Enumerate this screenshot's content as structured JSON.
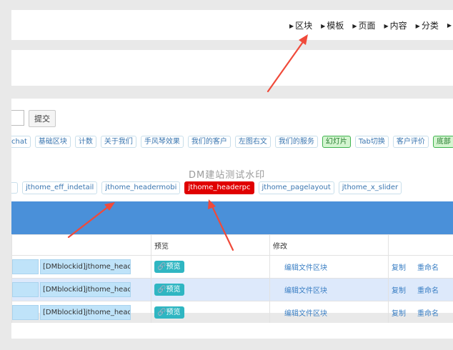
{
  "topnav": {
    "items": [
      "区块",
      "模板",
      "页面",
      "内容",
      "分类"
    ]
  },
  "toolbar": {
    "submit_label": "提交"
  },
  "tags": [
    {
      "label": "chat"
    },
    {
      "label": "基础区块"
    },
    {
      "label": "计数"
    },
    {
      "label": "关于我们"
    },
    {
      "label": "手风琴效果"
    },
    {
      "label": "我们的客户"
    },
    {
      "label": "左图右文"
    },
    {
      "label": "我们的服务"
    },
    {
      "label": "幻灯片",
      "highlight": true
    },
    {
      "label": "Tab切换"
    },
    {
      "label": "客户评价"
    },
    {
      "label": "底部",
      "highlight": true
    }
  ],
  "watermark": "DM建站测试水印",
  "templates": [
    "jthome_eff_indetail",
    "jthome_headermobi",
    "jthome_headerpc",
    "jthome_pagelayout",
    "jthome_x_slider"
  ],
  "active_template": "jthome_headerpc",
  "table": {
    "headers": [
      "",
      "预览",
      "修改",
      ""
    ],
    "rows": [
      {
        "id_value": "[DMblockid]jthome_header|",
        "preview_label": "预览",
        "edit_label": "编辑文件区块",
        "copy_label": "复制",
        "rename_label": "重命名"
      },
      {
        "id_value": "[DMblockid]jthome_header|",
        "preview_label": "预览",
        "edit_label": "编辑文件区块",
        "copy_label": "复制",
        "rename_label": "重命名"
      },
      {
        "id_value": "[DMblockid]jthome_header|",
        "preview_label": "预览",
        "edit_label": "编辑文件区块",
        "copy_label": "复制",
        "rename_label": "重命名"
      }
    ]
  },
  "colors": {
    "annotation_arrow": "#f04a3a",
    "blue_bar": "#4a90d9",
    "active_tag": "#e00000",
    "preview_button": "#2fb6c2"
  }
}
